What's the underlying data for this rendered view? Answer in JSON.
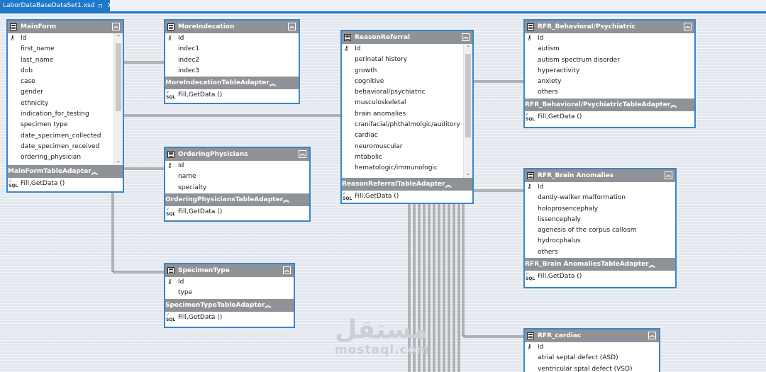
{
  "tab": {
    "title": "LaborDataBaseDataSet1.xsd",
    "pin": "⊓",
    "close": "✕"
  },
  "tables": {
    "mainform": {
      "title": "MainForm",
      "fields": [
        "Id",
        "first_name",
        "last_name",
        "dob",
        "case",
        "gender",
        "ethnicity",
        "indication_for_testing",
        "specimen type",
        "date_specimen_collected",
        "date_specimen_received",
        "ordering_physician"
      ],
      "adapter": "MainFormTableAdapter",
      "method": "Fill,GetData ()"
    },
    "moreindecation": {
      "title": "MoreIndecation",
      "fields": [
        "Id",
        "indec1",
        "indec2",
        "indec3"
      ],
      "adapter": "MoreIndecationTableAdapter",
      "method": "Fill,GetData ()"
    },
    "orderingphysicians": {
      "title": "OrderingPhysicians",
      "fields": [
        "Id",
        "name",
        "specialty"
      ],
      "adapter": "OrderingPhysiciansTableAdapter",
      "method": "Fill,GetData ()"
    },
    "specimentype": {
      "title": "SpecimenType",
      "fields": [
        "Id",
        "type"
      ],
      "adapter": "SpecimenTypeTableAdapter",
      "method": "Fill,GetData ()"
    },
    "reasonreferral": {
      "title": "ReasonReferral",
      "fields": [
        "Id",
        "perinatal history",
        "growth",
        "cognitive",
        "behavioral/psychiatric",
        "musculoskeletal",
        "brain anomalies",
        "cranifacial/phthalmolgic/auditory",
        "cardiac",
        "neuromuscular",
        "mtabolic",
        "hematologic/immunologic"
      ],
      "adapter": "ReasonReferralTableAdapter",
      "method": "Fill,GetData ()"
    },
    "rfr_behavioral": {
      "title": "RFR_Behavioral/Psychiatric",
      "fields": [
        "Id",
        "autism",
        "autism spectrum disorder",
        "hyperactivity",
        "anxiety",
        "others"
      ],
      "adapter": "RFR_Behavioral/PsychiatricTableAdapter",
      "method": "Fill,GetData ()"
    },
    "rfr_brain": {
      "title": "RFR_Brain Anomalies",
      "fields": [
        "Id",
        "dandy-walker malformation",
        "holoprosencephaly",
        "lissencephaly",
        "agenesis of the corpus callosm",
        "hydrocphalus",
        "others"
      ],
      "adapter": "RFR_Brain AnomaliesTableAdapter",
      "method": "Fill,GetData ()"
    },
    "rfr_cardiac": {
      "title": "RFR_cardiac",
      "fields": [
        "Id",
        "atrial septal defect (ASD)",
        "ventricular sptal defect (VSD)"
      ]
    }
  },
  "icons": {
    "key": "key-icon",
    "collapse": "double-chevron-up-icon",
    "sql": "sql-icon",
    "table": "table-icon"
  },
  "colors": {
    "tab_accent": "#1d78c9",
    "header": "#8f9398",
    "border": "#3a86c8"
  },
  "watermark": {
    "arabic": "مستقل",
    "latin": "mostaql.com"
  }
}
